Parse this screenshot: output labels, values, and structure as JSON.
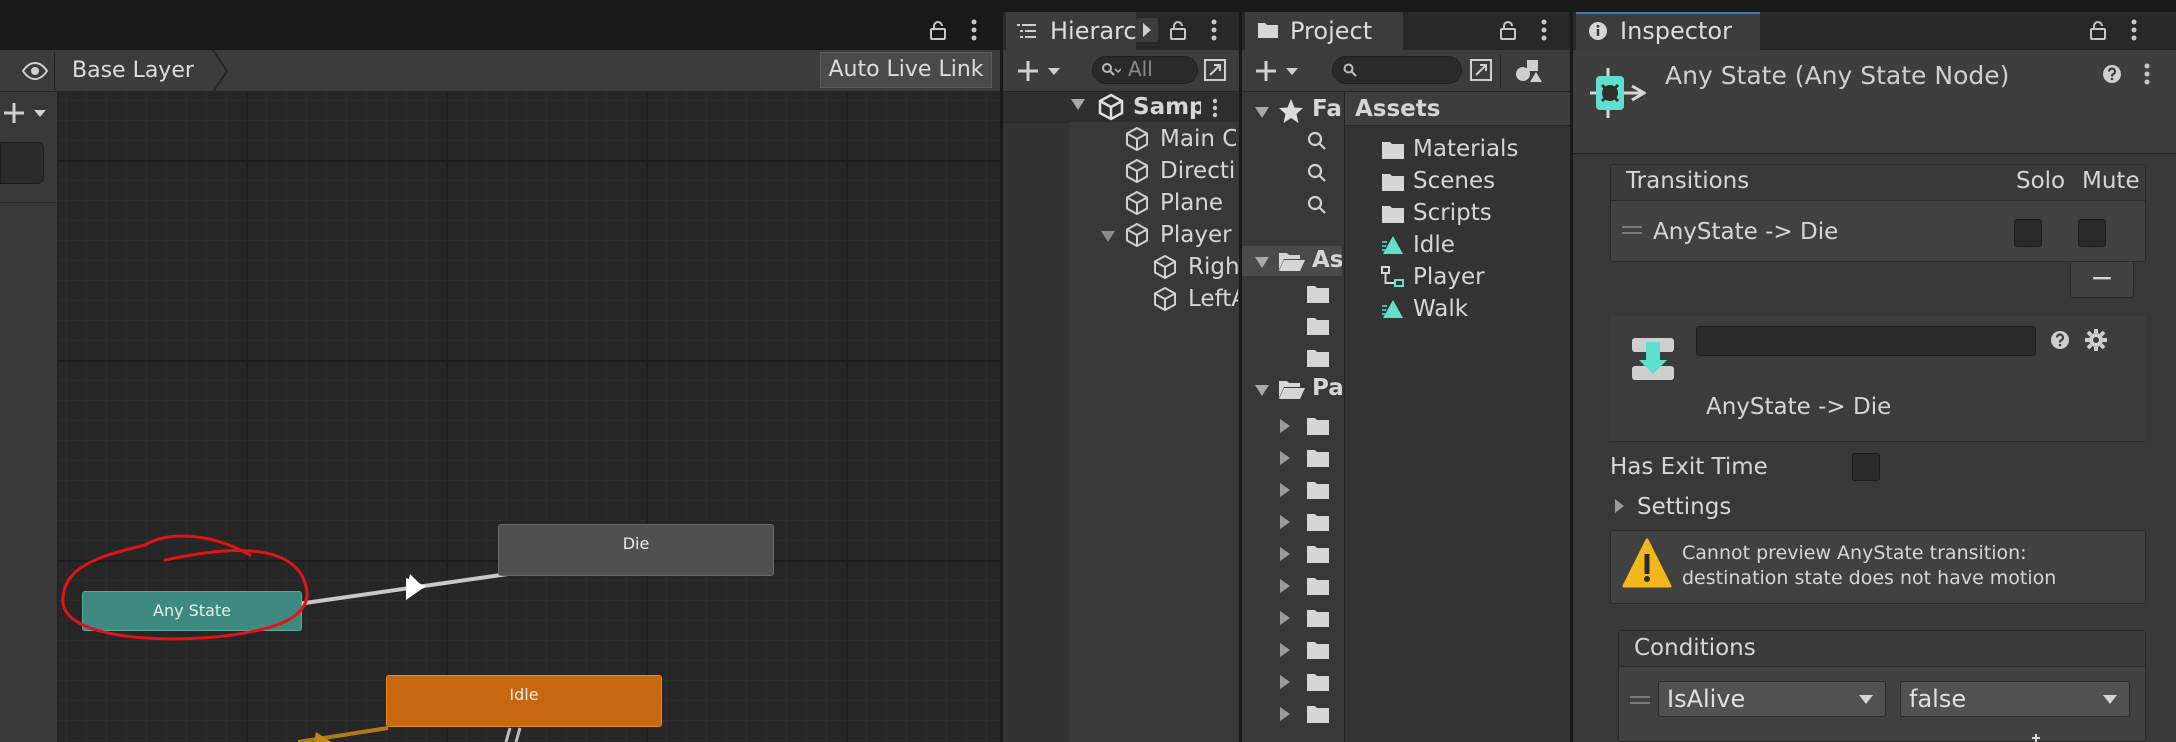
{
  "animator": {
    "breadcrumb": "Base Layer",
    "auto_live_link": "Auto Live Link",
    "nodes": {
      "any_state": "Any State",
      "die": "Die",
      "idle": "Idle"
    }
  },
  "hierarchy": {
    "tab": "Hierarc",
    "search_placeholder": "All",
    "items": [
      {
        "label": "Samp"
      },
      {
        "label": "Main C"
      },
      {
        "label": "Directio"
      },
      {
        "label": "Plane"
      },
      {
        "label": "Player"
      },
      {
        "label": "Righ"
      },
      {
        "label": "LeftA"
      }
    ]
  },
  "project": {
    "tab": "Project",
    "tree": {
      "favorites": "Fa",
      "assets": "As",
      "packages": "Pa"
    },
    "assets_header": "Assets",
    "assets": [
      {
        "label": "Materials",
        "icon": "folder-icon"
      },
      {
        "label": "Scenes",
        "icon": "folder-icon"
      },
      {
        "label": "Scripts",
        "icon": "folder-icon"
      },
      {
        "label": "Idle",
        "icon": "animation-clip-icon"
      },
      {
        "label": "Player",
        "icon": "animator-controller-icon"
      },
      {
        "label": "Walk",
        "icon": "animation-clip-icon"
      }
    ]
  },
  "inspector": {
    "tab": "Inspector",
    "title": "Any State (Any State Node)",
    "transitions": {
      "header": "Transitions",
      "solo": "Solo",
      "mute": "Mute",
      "row": "AnyState -> Die"
    },
    "remove_button": "−",
    "transition_name_value": "",
    "transition_label": "AnyState -> Die",
    "has_exit_time": "Has Exit Time",
    "settings": "Settings",
    "warning": {
      "line1": "Cannot preview AnyState transition:",
      "line2": "destination state does not have motion"
    },
    "conditions": {
      "header": "Conditions",
      "parameter": "IsAlive",
      "value": "false"
    }
  },
  "colors": {
    "any_state": "#3f8a80",
    "idle": "#c8680e",
    "die": "#505050",
    "annotation": "#e01414",
    "warning": "#f2b81b",
    "clip_icon": "#5fe0cf"
  }
}
